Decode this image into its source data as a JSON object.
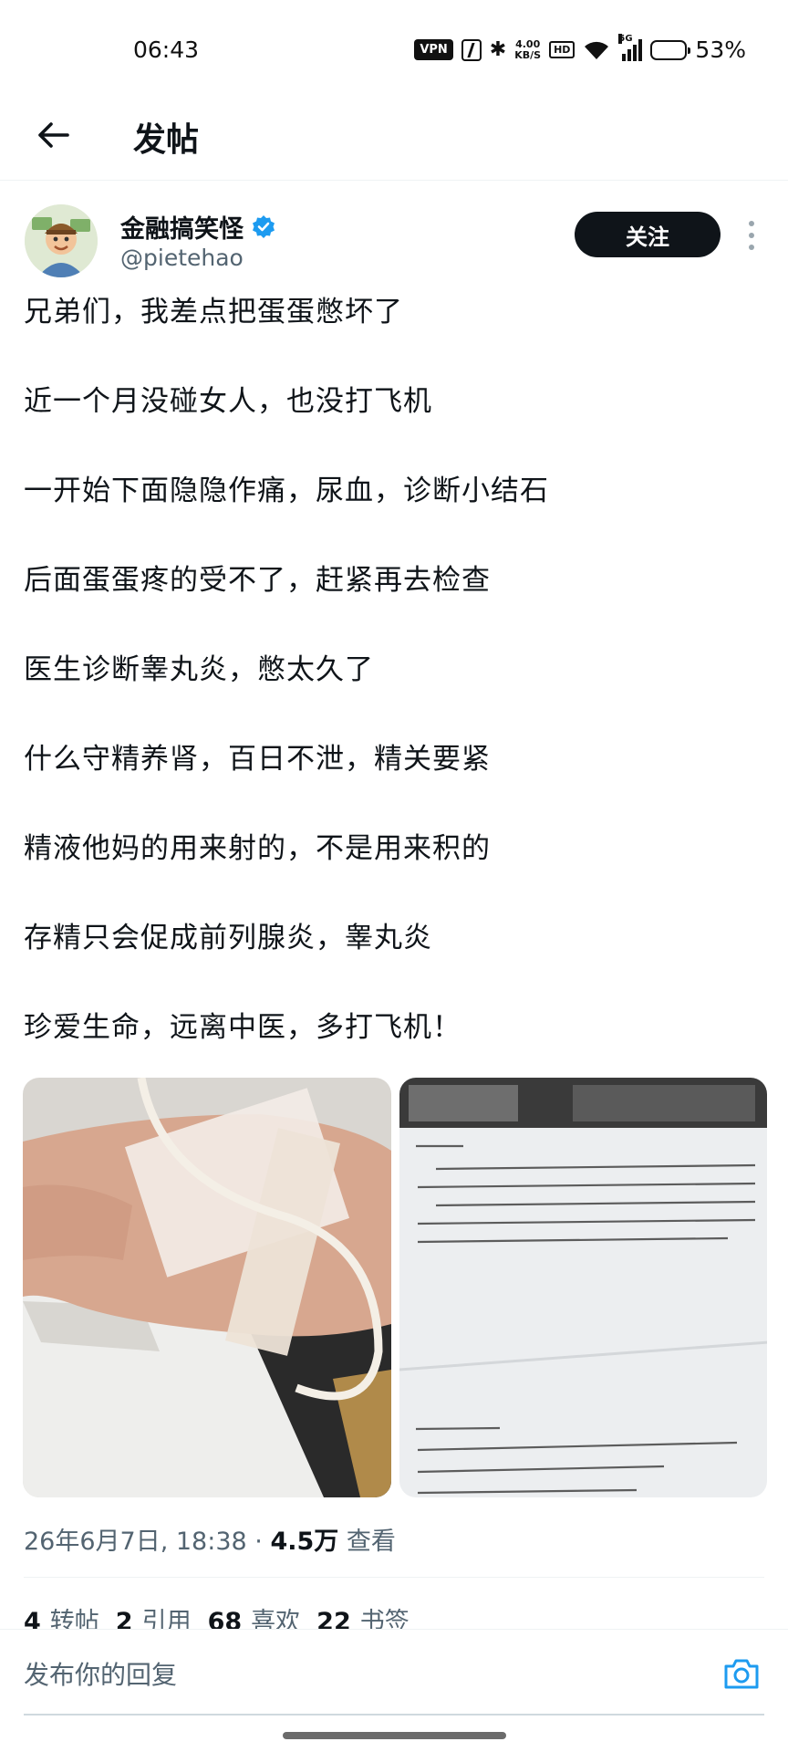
{
  "status_bar": {
    "time": "06:43",
    "vpn": "VPN",
    "speed_value": "4.00",
    "speed_unit": "KB/S",
    "hd": "HD",
    "network": "5G",
    "battery_pct": "53%",
    "battery_level": 0.53
  },
  "header": {
    "title": "发帖",
    "back_icon": "arrow-left-icon"
  },
  "author": {
    "name": "金融搞笑怪",
    "handle": "@pietehao",
    "verified": true,
    "follow_label": "关注"
  },
  "post": {
    "lines": [
      "兄弟们，我差点把蛋蛋憋坏了",
      "近一个月没碰女人，也没打飞机",
      "一开始下面隐隐作痛，尿血，诊断小结石",
      "后面蛋蛋疼的受不了，赶紧再去检查",
      "医生诊断睾丸炎，憋太久了",
      "什么守精养肾，百日不泄，精关要紧",
      "精液他妈的用来射的，不是用来积的",
      "存精只会促成前列腺炎，睾丸炎",
      "珍爱生命，远离中医，多打飞机！"
    ]
  },
  "meta": {
    "datetime": "26年6月7日, 18:38",
    "separator": "·",
    "views_count": "4.5万",
    "views_label": "查看"
  },
  "stats": {
    "reposts_count": "4",
    "reposts_label": "转帖",
    "quotes_count": "2",
    "quotes_label": "引用",
    "likes_count": "68",
    "likes_label": "喜欢",
    "bookmarks_count": "22",
    "bookmarks_label": "书签"
  },
  "reply": {
    "placeholder": "发布你的回复",
    "camera_icon": "camera-icon"
  },
  "colors": {
    "text_primary": "#0f1419",
    "text_secondary": "#536471",
    "verified_blue": "#1d9bf0",
    "follow_bg": "#0f1419"
  }
}
